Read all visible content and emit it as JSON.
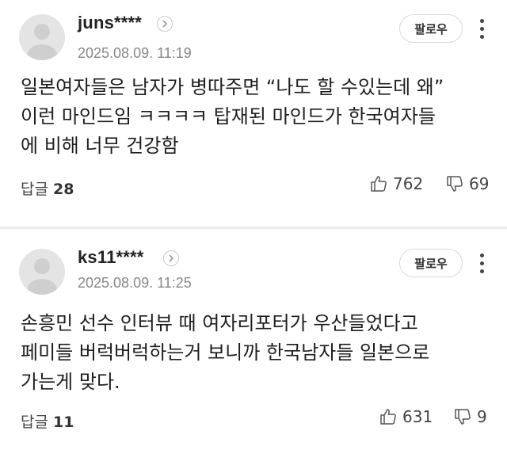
{
  "comments": [
    {
      "author": "juns****",
      "timestamp": "2025.08.09. 11:19",
      "follow_label": "팔로우",
      "lines": [
        "일본여자들은 남자가 병따주면 “나도 할 수있는데 왜”",
        "이런 마인드임 ㅋㅋㅋㅋ 탑재된 마인드가 한국여자들",
        "에 비해 너무 건강함"
      ],
      "reply_label": "답글",
      "reply_count": "28",
      "likes": "762",
      "dislikes": "69"
    },
    {
      "author": "ks11****",
      "timestamp": "2025.08.09. 11:25",
      "follow_label": "팔로우",
      "lines": [
        "손흥민 선수 인터뷰 때 여자리포터가 우산들었다고",
        "페미들 버럭버럭하는거 보니까 한국남자들 일본으로",
        "가는게 맞다."
      ],
      "reply_label": "답글",
      "reply_count": "11",
      "likes": "631",
      "dislikes": "9"
    }
  ],
  "icons": {
    "avatar": "default-avatar",
    "profile_arrow": "chevron-right-icon",
    "more": "more-vertical-icon",
    "like": "thumbs-up-icon",
    "dislike": "thumbs-down-icon"
  }
}
